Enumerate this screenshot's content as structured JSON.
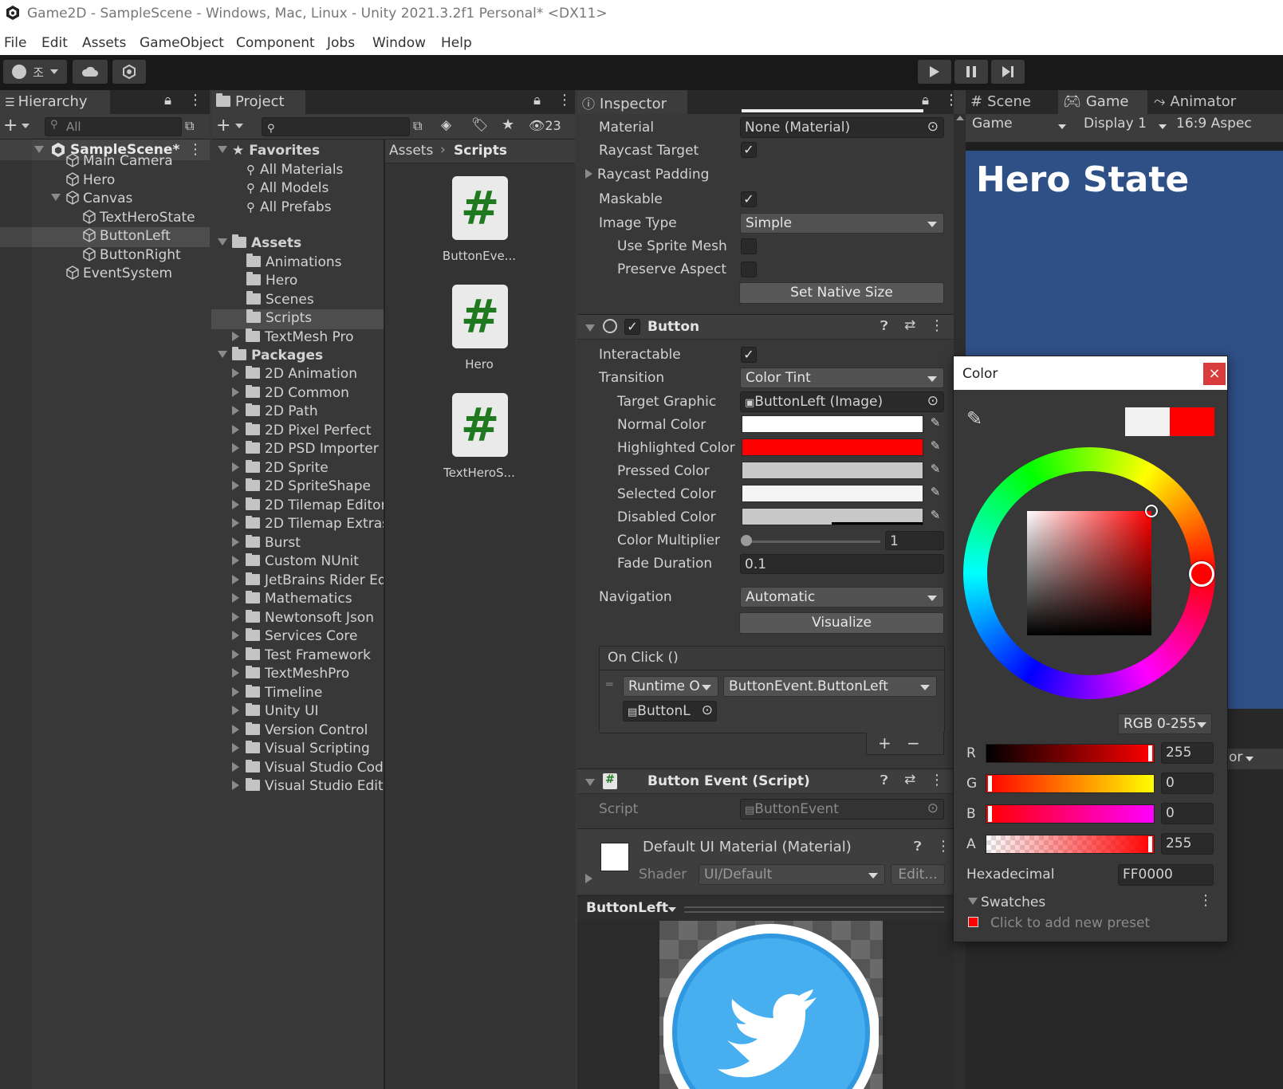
{
  "window": {
    "title": "Game2D - SampleScene - Windows, Mac, Linux - Unity 2021.3.2f1 Personal* <DX11>"
  },
  "menu": [
    "File",
    "Edit",
    "Assets",
    "GameObject",
    "Component",
    "Jobs",
    "Window",
    "Help"
  ],
  "toolbar": {
    "account_label": "조"
  },
  "hierarchy": {
    "tab": "Hierarchy",
    "search_placeholder": "All",
    "scene": "SampleScene*",
    "items": [
      "Main Camera",
      "Hero",
      "Canvas",
      "TextHeroState",
      "ButtonLeft",
      "ButtonRight",
      "EventSystem"
    ]
  },
  "project": {
    "tab": "Project",
    "hidden_count": "23",
    "favorites_label": "Favorites",
    "favorites": [
      "All Materials",
      "All Models",
      "All Prefabs"
    ],
    "assets_label": "Assets",
    "assets": [
      "Animations",
      "Hero",
      "Scenes",
      "Scripts",
      "TextMesh Pro"
    ],
    "packages_label": "Packages",
    "packages": [
      "2D Animation",
      "2D Common",
      "2D Path",
      "2D Pixel Perfect",
      "2D PSD Importer",
      "2D Sprite",
      "2D SpriteShape",
      "2D Tilemap Editor",
      "2D Tilemap Extras",
      "Burst",
      "Custom NUnit",
      "JetBrains Rider Editor",
      "Mathematics",
      "Newtonsoft Json",
      "Services Core",
      "Test Framework",
      "TextMeshPro",
      "Timeline",
      "Unity UI",
      "Version Control",
      "Visual Scripting",
      "Visual Studio Code Editor",
      "Visual Studio Editor"
    ],
    "breadcrumb": [
      "Assets",
      "Scripts"
    ],
    "files": [
      "ButtonEve...",
      "Hero",
      "TextHeroS..."
    ]
  },
  "inspector": {
    "tab": "Inspector",
    "image": {
      "material_label": "Material",
      "material_value": "None (Material)",
      "raycast_target_label": "Raycast Target",
      "raycast_padding_label": "Raycast Padding",
      "maskable_label": "Maskable",
      "image_type_label": "Image Type",
      "image_type_value": "Simple",
      "use_sprite_mesh_label": "Use Sprite Mesh",
      "preserve_aspect_label": "Preserve Aspect",
      "set_native_size": "Set Native Size"
    },
    "button": {
      "title": "Button",
      "interactable_label": "Interactable",
      "transition_label": "Transition",
      "transition_value": "Color Tint",
      "target_graphic_label": "Target Graphic",
      "target_graphic_value": "ButtonLeft (Image)",
      "normal_label": "Normal Color",
      "normal_color": "#ffffff",
      "highlighted_label": "Highlighted Color",
      "highlighted_color": "#ff0000",
      "pressed_label": "Pressed Color",
      "pressed_color": "#c8c8c8",
      "selected_label": "Selected Color",
      "selected_color": "#f5f5f5",
      "disabled_label": "Disabled Color",
      "disabled_color": "#c8c8c8",
      "multiplier_label": "Color Multiplier",
      "multiplier_value": "1",
      "fade_label": "Fade Duration",
      "fade_value": "0.1",
      "navigation_label": "Navigation",
      "navigation_value": "Automatic",
      "visualize": "Visualize",
      "onclick_label": "On Click ()",
      "runtime_value": "Runtime O",
      "function_value": "ButtonEvent.ButtonLeft",
      "object_value": "ButtonL",
      "add": "+",
      "remove": "−"
    },
    "script": {
      "title": "Button Event (Script)",
      "script_label": "Script",
      "script_value": "ButtonEvent"
    },
    "material": {
      "title": "Default UI Material (Material)",
      "shader_label": "Shader",
      "shader_value": "UI/Default",
      "edit": "Edit..."
    },
    "preview": {
      "title": "ButtonLeft"
    }
  },
  "game": {
    "tabs": [
      "Scene",
      "Game",
      "Animator"
    ],
    "game_dropdown": "Game",
    "display": "Display 1",
    "aspect": "16:9 Aspec",
    "hero_state": "Hero State",
    "partial_dropdown": "or"
  },
  "color_picker": {
    "title": "Color",
    "close": "×",
    "old_color": "#f2f2f2",
    "new_color": "#ff0000",
    "mode": "RGB 0-255",
    "r_label": "R",
    "r_value": "255",
    "g_label": "G",
    "g_value": "0",
    "b_label": "B",
    "b_value": "0",
    "a_label": "A",
    "a_value": "255",
    "hex_label": "Hexadecimal",
    "hex_value": "FF0000",
    "swatches_label": "Swatches",
    "swatches_hint": "Click to add new preset"
  },
  "colors": {
    "accent_blue": "#2f4f87",
    "editor_bg": "#383838",
    "tab_bg": "#282828"
  }
}
